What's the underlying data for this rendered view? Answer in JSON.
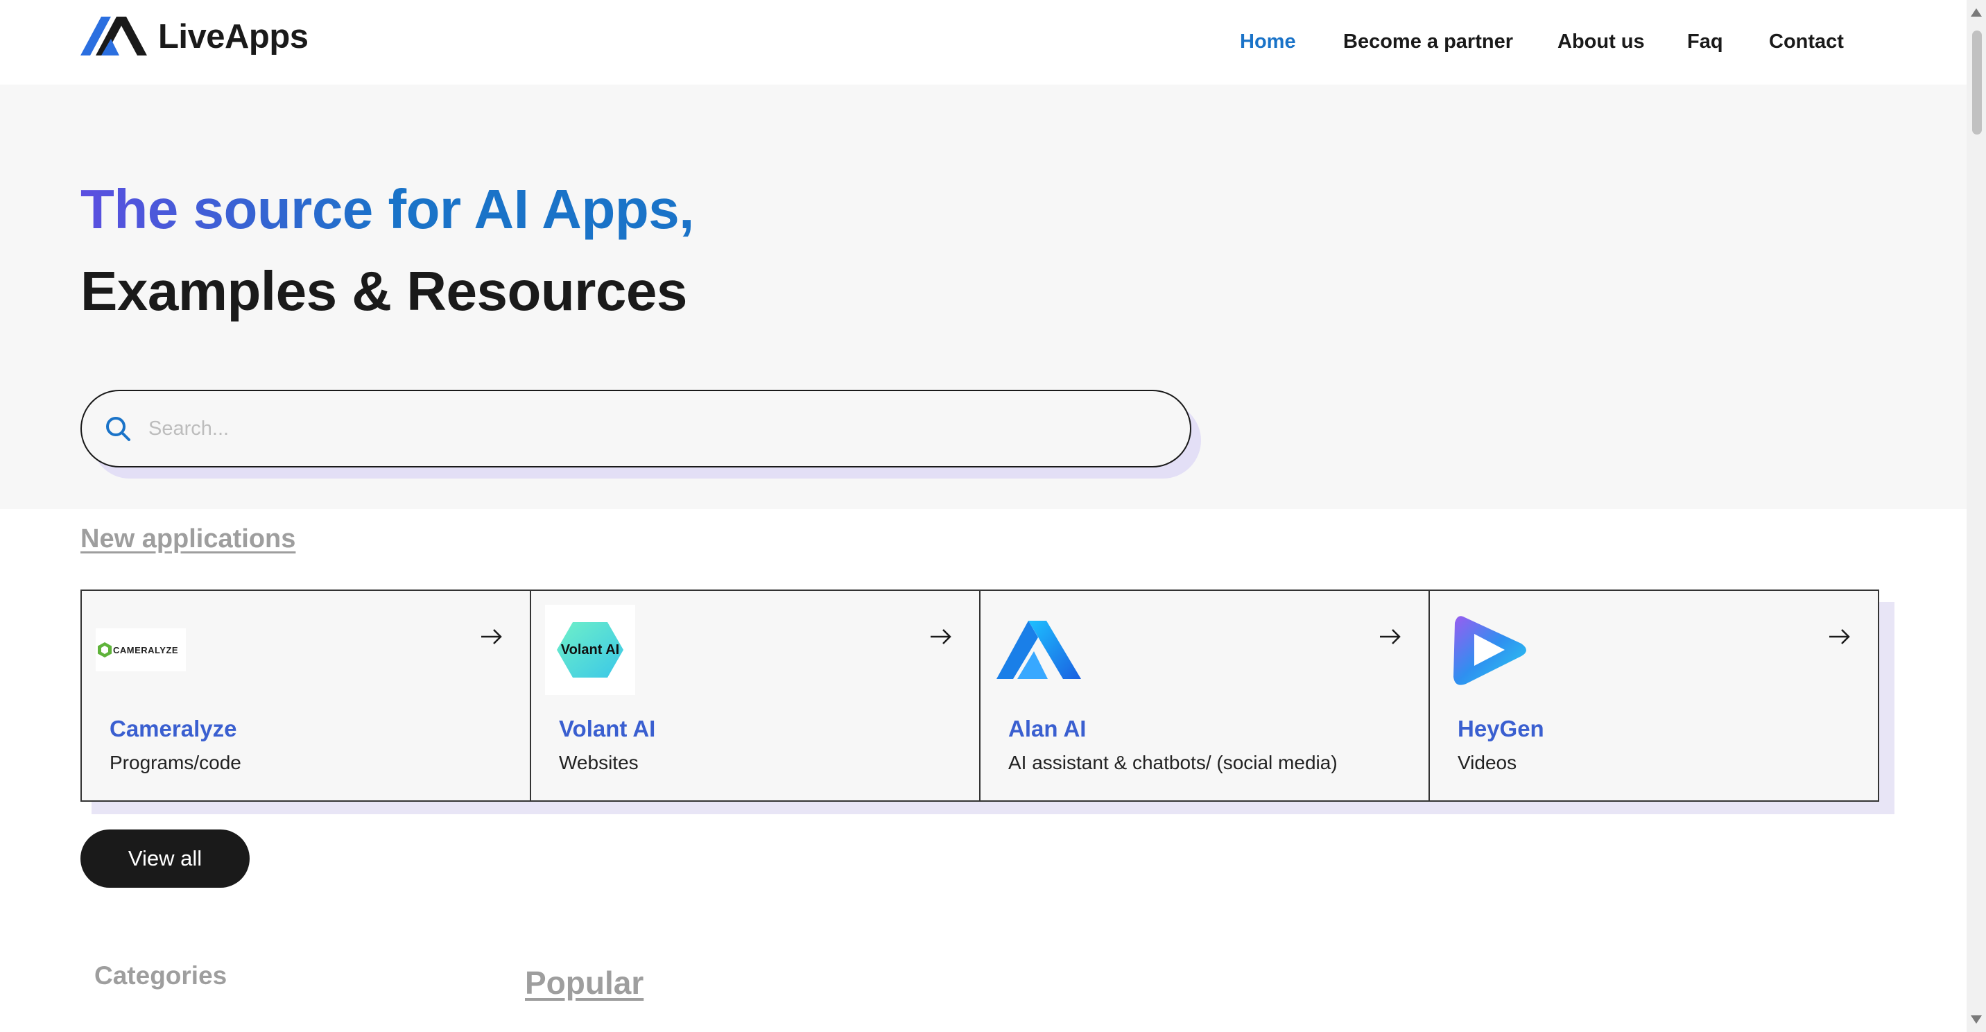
{
  "brand": {
    "name": "LiveApps",
    "logo_icon": "liveapps-logo-icon"
  },
  "nav": {
    "items": [
      {
        "label": "Home",
        "active": true
      },
      {
        "label": "Become a partner",
        "active": false
      },
      {
        "label": "About us",
        "active": false
      },
      {
        "label": "Faq",
        "active": false
      },
      {
        "label": "Contact",
        "active": false
      }
    ]
  },
  "hero": {
    "title_line1": "The source for AI Apps,",
    "title_line2": "Examples & Resources"
  },
  "search": {
    "placeholder": "Search...",
    "value": "",
    "icon": "search-icon"
  },
  "new_applications": {
    "heading": "New applications",
    "cards": [
      {
        "name": "Cameralyze",
        "category": "Programs/code",
        "logo_text": "CAMERALYZE",
        "icon": "arrow-right-icon"
      },
      {
        "name": "Volant AI",
        "category": "Websites",
        "logo_text": "Volant AI",
        "icon": "arrow-right-icon"
      },
      {
        "name": "Alan AI",
        "category": "AI assistant & chatbots/ (social media)",
        "logo_text": "",
        "icon": "arrow-right-icon"
      },
      {
        "name": "HeyGen",
        "category": "Videos",
        "logo_text": "",
        "icon": "arrow-right-icon"
      }
    ],
    "view_all_label": "View all"
  },
  "categories_heading": "Categories",
  "popular_heading": "Popular",
  "colors": {
    "accent": "#1a73c8",
    "card_name": "#3a5fd0",
    "hero_bg": "#f7f7f7",
    "shadow": "#e3dff6",
    "dark": "#1a1a1a"
  }
}
